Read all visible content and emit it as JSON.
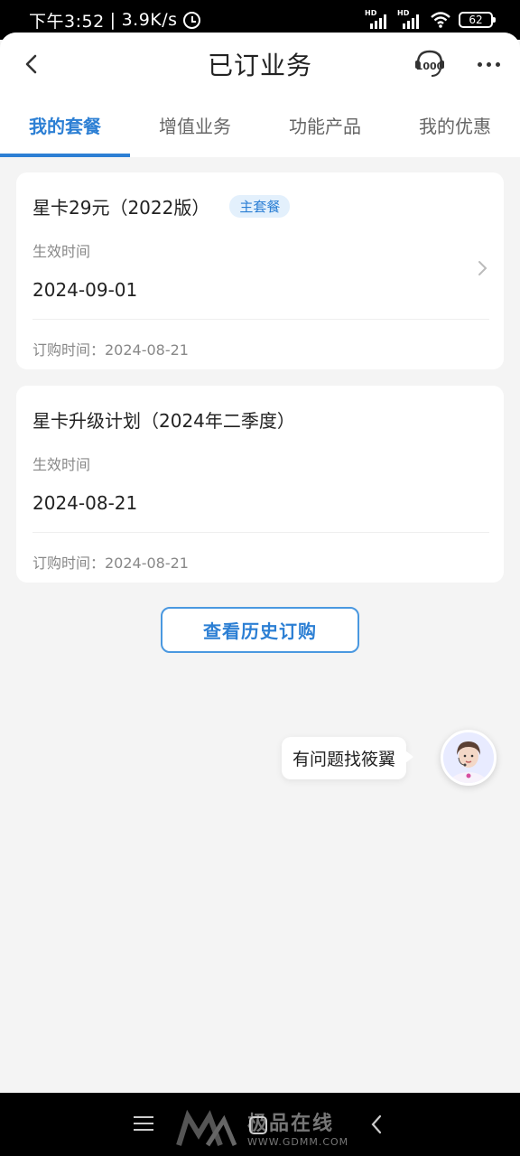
{
  "status_bar": {
    "time": "下午3:52",
    "speed": "3.9K/s",
    "hd1": "HD",
    "hd2": "HD",
    "battery": "62"
  },
  "header": {
    "title": "已订业务"
  },
  "tabs": [
    {
      "label": "我的套餐",
      "active": true
    },
    {
      "label": "增值业务",
      "active": false
    },
    {
      "label": "功能产品",
      "active": false
    },
    {
      "label": "我的优惠",
      "active": false
    }
  ],
  "cards": [
    {
      "title": "星卡29元（2022版）",
      "badge": "主套餐",
      "effective_label": "生效时间",
      "effective_date": "2024-09-01",
      "order_text": "订购时间：2024-08-21"
    },
    {
      "title": "星卡升级计划（2024年二季度）",
      "effective_label": "生效时间",
      "effective_date": "2024-08-21",
      "order_text": "订购时间：2024-08-21"
    }
  ],
  "history_button": "查看历史订购",
  "assistant": {
    "bubble": "有问题找筱翼"
  },
  "watermark": {
    "main": "极品在线",
    "url": "WWW.GDMM.COM"
  },
  "colors": {
    "accent": "#2c7fd4",
    "badge_bg": "#e3f0fc",
    "page_bg": "#f4f4f4"
  }
}
